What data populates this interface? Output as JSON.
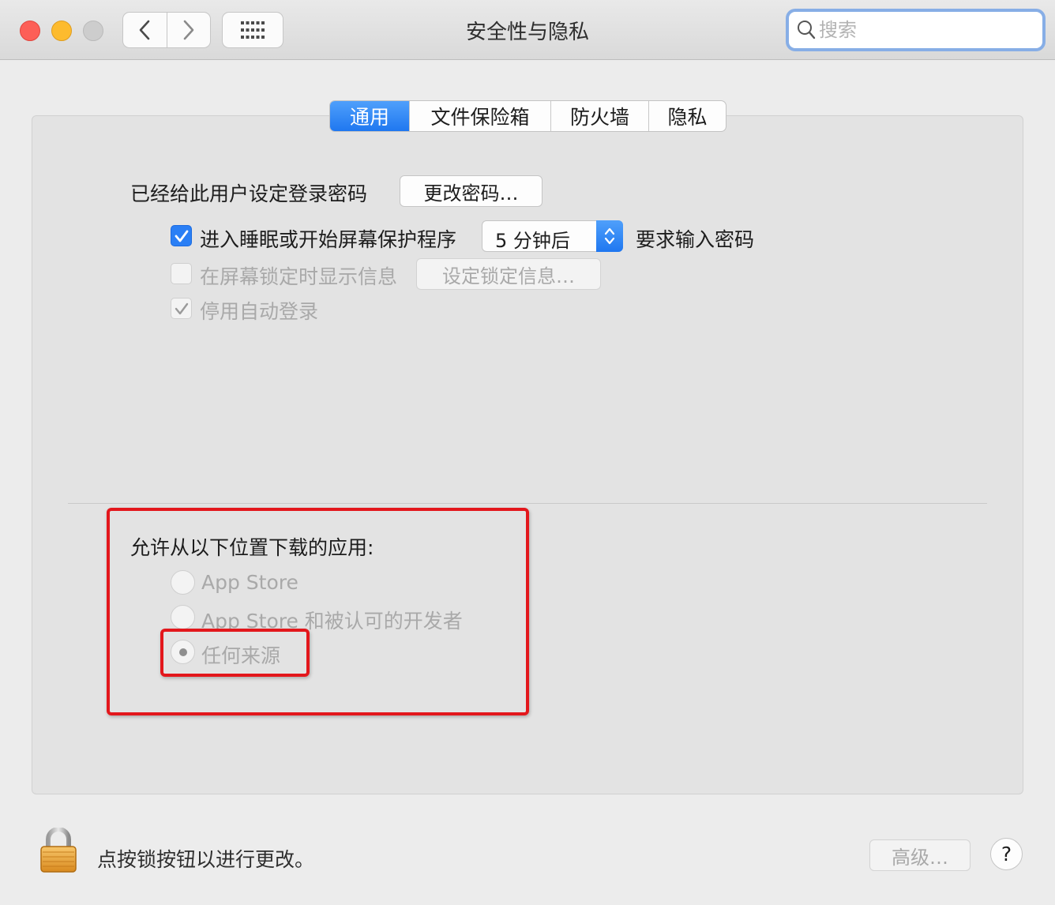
{
  "window": {
    "title": "安全性与隐私",
    "search_placeholder": "搜索"
  },
  "tabs": [
    {
      "label": "通用",
      "active": true
    },
    {
      "label": "文件保险箱",
      "active": false
    },
    {
      "label": "防火墙",
      "active": false
    },
    {
      "label": "隐私",
      "active": false
    }
  ],
  "general": {
    "password_label": "已经给此用户设定登录密码",
    "change_password_button": "更改密码…",
    "require_password": {
      "checked": true,
      "label_before": "进入睡眠或开始屏幕保护程序",
      "delay_value": "5 分钟后",
      "label_after": "要求输入密码"
    },
    "show_message": {
      "checked": false,
      "label": "在屏幕锁定时显示信息",
      "button": "设定锁定信息…"
    },
    "disable_auto_login": {
      "checked": true,
      "label": "停用自动登录"
    }
  },
  "downloads": {
    "heading": "允许从以下位置下载的应用:",
    "options": [
      {
        "label": "App Store",
        "selected": false
      },
      {
        "label": "App Store 和被认可的开发者",
        "selected": false
      },
      {
        "label": "任何来源",
        "selected": true
      }
    ]
  },
  "footer": {
    "lock_text": "点按锁按钮以进行更改。",
    "advanced_button": "高级…",
    "help_button": "?"
  },
  "colors": {
    "accent": "#1f77f0",
    "highlight": "#e3171c"
  }
}
